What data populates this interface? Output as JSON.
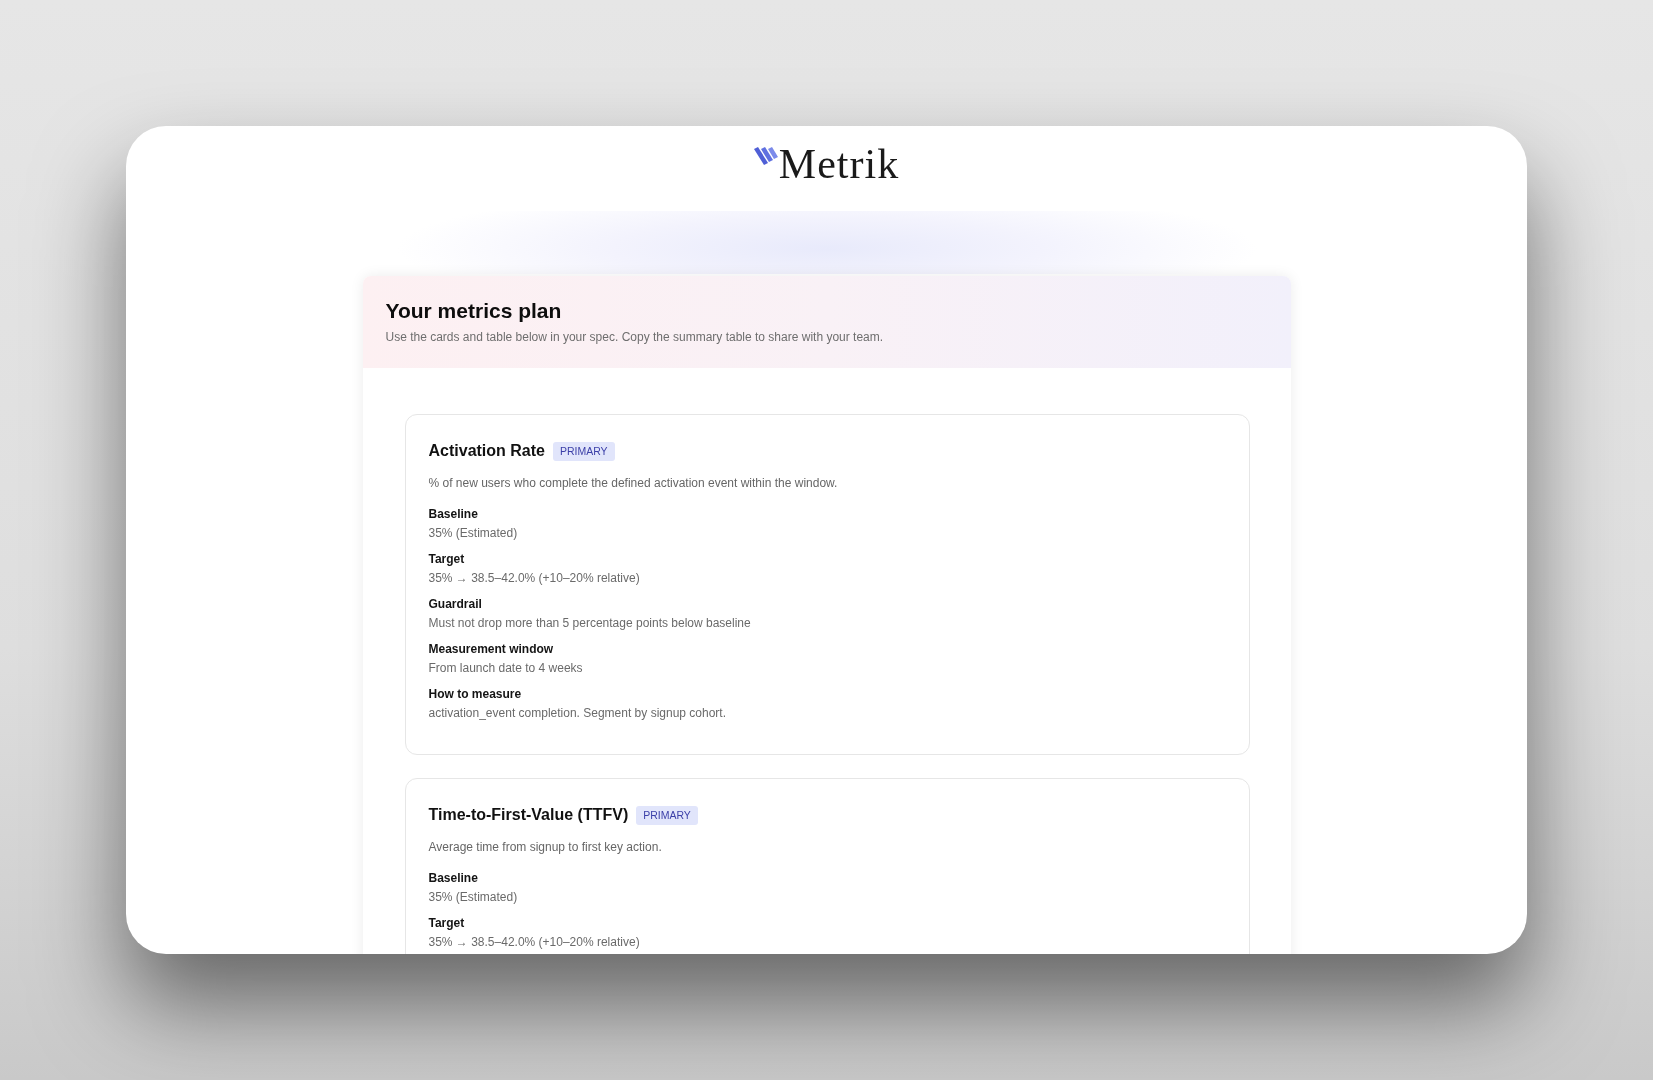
{
  "logo": {
    "text": "Metrik"
  },
  "plan": {
    "title": "Your metrics plan",
    "subtitle": "Use the cards and table below in your spec. Copy the summary table to share with your team."
  },
  "metrics": [
    {
      "name": "Activation Rate",
      "badge": "PRIMARY",
      "description": "% of new users who complete the defined activation event within the window.",
      "fields": [
        {
          "label": "Baseline",
          "value": "35% (Estimated)"
        },
        {
          "label": "Target",
          "value": "35% → 38.5–42.0% (+10–20% relative)"
        },
        {
          "label": "Guardrail",
          "value": "Must not drop more than 5 percentage points below baseline"
        },
        {
          "label": "Measurement window",
          "value": "From launch date to 4 weeks"
        },
        {
          "label": "How to measure",
          "value": "activation_event completion. Segment by signup cohort."
        }
      ]
    },
    {
      "name": "Time-to-First-Value (TTFV)",
      "badge": "PRIMARY",
      "description": "Average time from signup to first key action.",
      "fields": [
        {
          "label": "Baseline",
          "value": "35% (Estimated)"
        },
        {
          "label": "Target",
          "value": "35% → 38.5–42.0% (+10–20% relative)"
        }
      ]
    }
  ]
}
